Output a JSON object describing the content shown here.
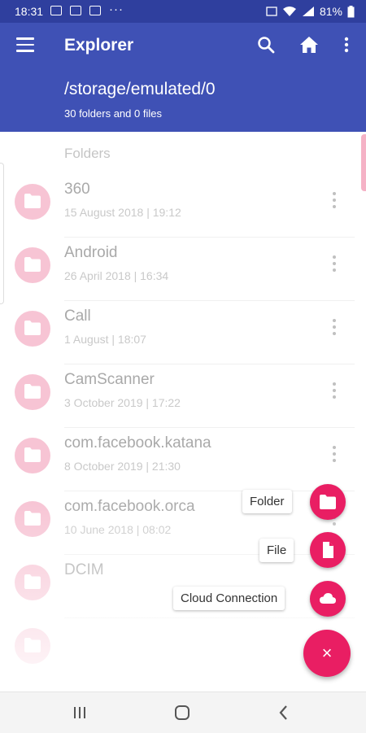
{
  "status_bar": {
    "time": "18:31",
    "overflow": "···",
    "battery": "81%"
  },
  "app_bar": {
    "title": "Explorer",
    "path": "/storage/emulated/0",
    "summary": "30 folders and 0 files"
  },
  "list": {
    "section_label": "Folders",
    "items": [
      {
        "name": "360",
        "date": "15 August 2018 | 19:12"
      },
      {
        "name": "Android",
        "date": "26 April 2018 | 16:34"
      },
      {
        "name": "Call",
        "date": "1 August | 18:07"
      },
      {
        "name": "CamScanner",
        "date": "3 October 2019 | 17:22"
      },
      {
        "name": "com.facebook.katana",
        "date": "8 October 2019 | 21:30"
      },
      {
        "name": "com.facebook.orca",
        "date": "10 June 2018 | 08:02"
      },
      {
        "name": "DCIM",
        "date": ""
      },
      {
        "name": "",
        "date": ""
      }
    ]
  },
  "fab_menu": {
    "folder_label": "Folder",
    "file_label": "File",
    "cloud_label": "Cloud Connection",
    "close_symbol": "×"
  },
  "colors": {
    "primary": "#3f51b5",
    "status_bar": "#2f3f9e",
    "accent": "#e91e63",
    "folder_avatar": "#f7c4d4"
  }
}
